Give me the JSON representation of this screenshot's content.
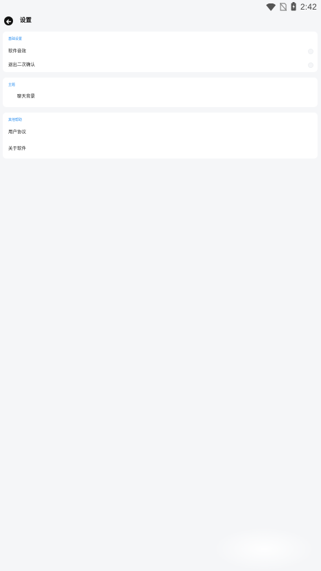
{
  "status_bar": {
    "time": "2:42",
    "icons": [
      "wifi-icon",
      "no-sim-icon",
      "battery-charging-icon"
    ]
  },
  "header": {
    "title": "设置",
    "back_icon": "arrow-left-icon"
  },
  "sections": {
    "basic": {
      "label": "基础设置",
      "items": [
        {
          "label": "软件音效",
          "toggle_on": false
        },
        {
          "label": "退出二次确认",
          "toggle_on": false
        }
      ]
    },
    "theme": {
      "label": "主题",
      "items": [
        {
          "label": "聊天背景"
        }
      ]
    },
    "about": {
      "label": "其他帮助",
      "items": [
        {
          "label": "用户协议"
        },
        {
          "label": "关于软件"
        }
      ]
    }
  },
  "colors": {
    "accent": "#2b8ff0",
    "background": "#f5f6f8",
    "card": "#ffffff"
  }
}
